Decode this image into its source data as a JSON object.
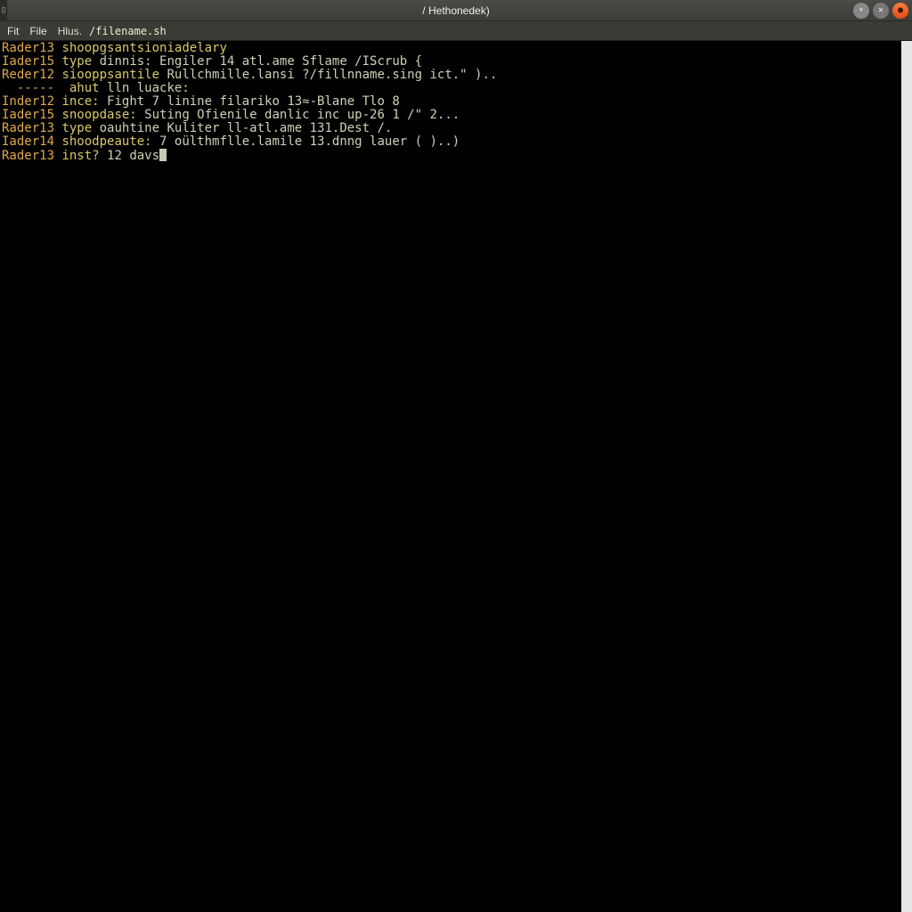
{
  "window": {
    "title": "/ Hethonedek)",
    "left_ornament": "▯"
  },
  "menubar": {
    "items": [
      {
        "label": "Fit"
      },
      {
        "label": "File"
      },
      {
        "label": "Hlus."
      }
    ],
    "path": "/filename.sh"
  },
  "terminal": {
    "lines": [
      {
        "prompt": "Rader13",
        "keyword": "shoopgsantsioniadelary",
        "rest": ""
      },
      {
        "prompt": "Iader15",
        "keyword": "type",
        "rest": " dinnis: Engiler 14 atl.ame Sflame /IScrub {"
      },
      {
        "prompt": "Reder12",
        "keyword": "siooppsantile",
        "rest": " Rullchmille.lansi ?/fillnname.sing ict.\" ).."
      },
      {
        "prompt": "  ----- ",
        "keyword": "ahut",
        "rest": " lln luacke:"
      },
      {
        "prompt": "Inder12",
        "keyword": "ince:",
        "rest": " Fight 7 linine filariko 13≈-Blane Tlo 8"
      },
      {
        "prompt": "Iader15",
        "keyword": "snoopdase:",
        "rest": " Suting Ofienile danlic inc up-26 1 /\" 2..."
      },
      {
        "prompt": "Rader13",
        "keyword": "type",
        "rest": " oauhtine Kuliter ll-atl.ame 131.Dest /."
      },
      {
        "prompt": "Iader14",
        "keyword": "shoodpeaute:",
        "rest": " 7 oülthmflle.lamile 13.dnng lauer ( )..)"
      },
      {
        "prompt": "Rader13",
        "keyword": "inst?",
        "rest": " 12 davs"
      }
    ]
  },
  "icons": {
    "minimize": "▾",
    "close_x": "✕",
    "close_dot": "●"
  }
}
